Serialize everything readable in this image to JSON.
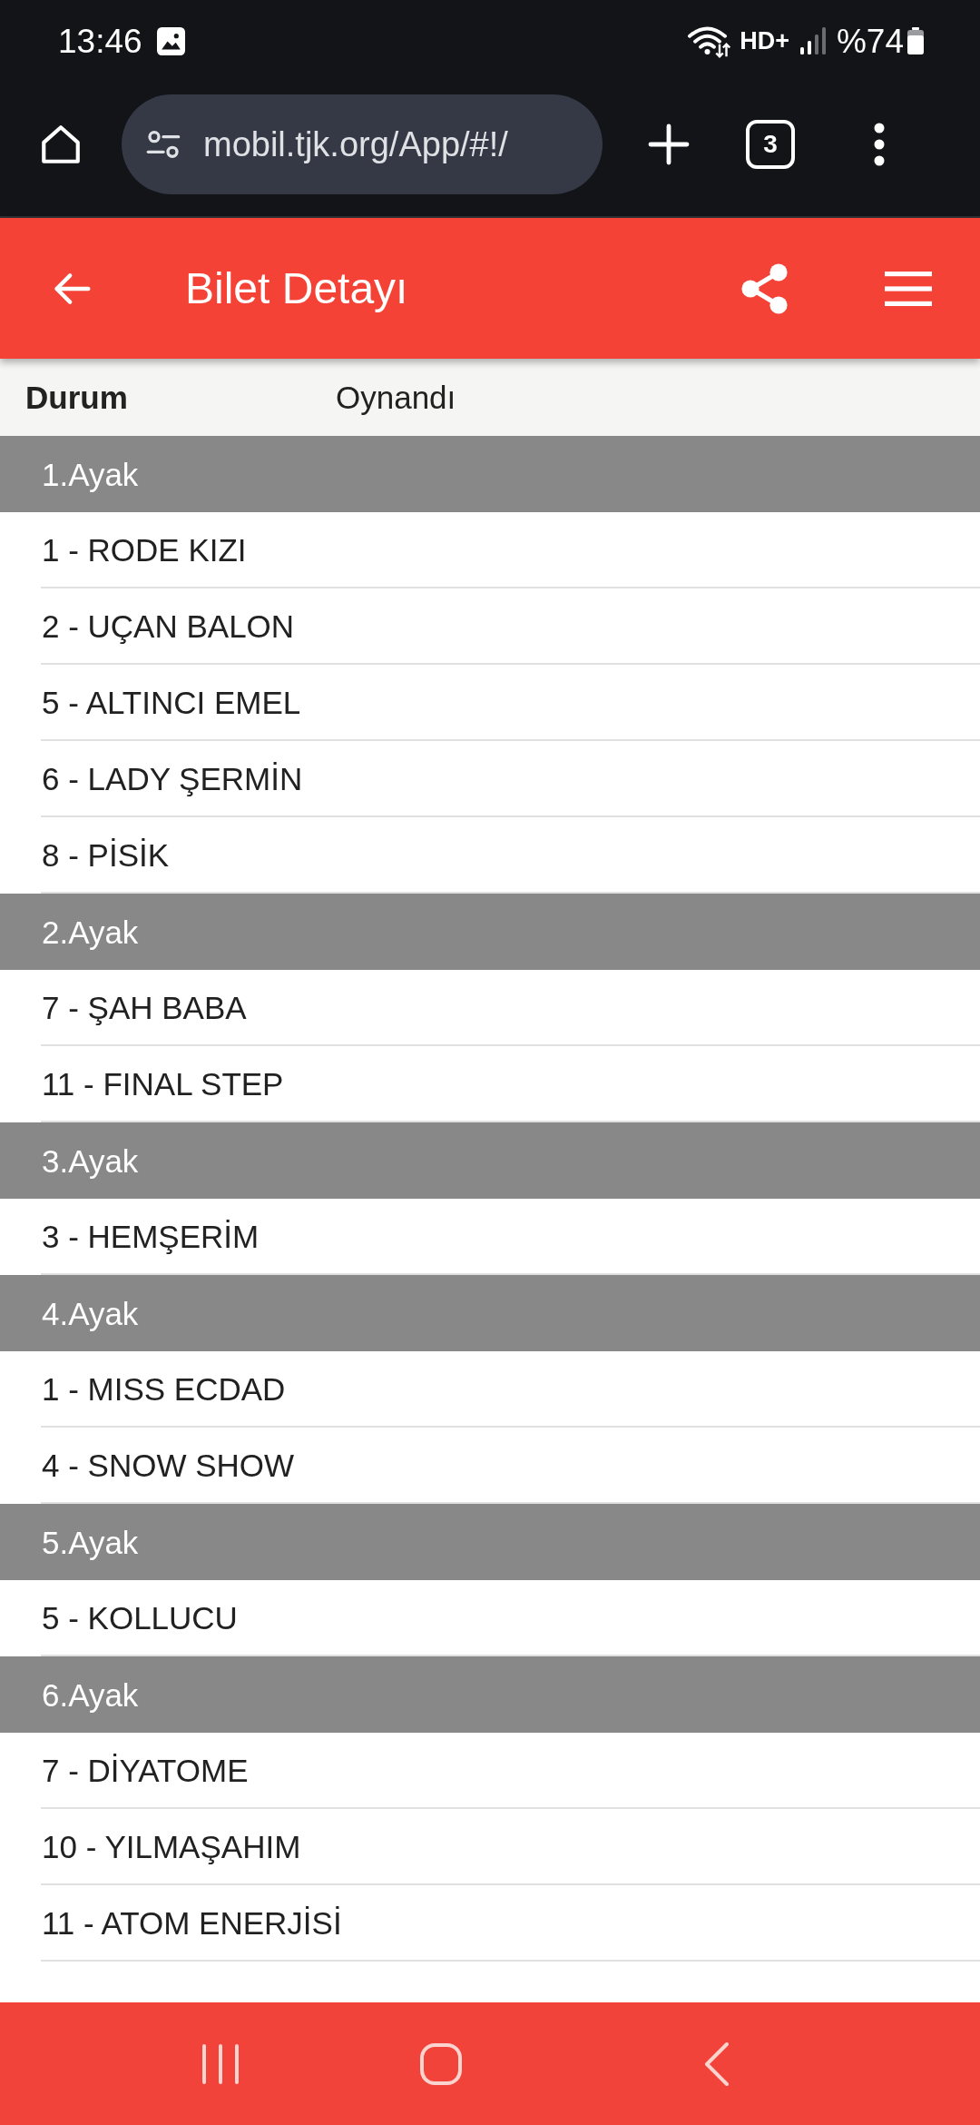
{
  "status_bar": {
    "time": "13:46",
    "network_badge": "HD+",
    "battery": "%74"
  },
  "browser_toolbar": {
    "url": "mobil.tjk.org/App/#!/",
    "tab_count": "3"
  },
  "app_bar": {
    "title": "Bilet Detayı"
  },
  "status_row": {
    "label": "Durum",
    "value": "Oynandı"
  },
  "legs": [
    {
      "title": "1.Ayak",
      "horses": [
        "1 - RODE KIZI",
        "2 - UÇAN BALON",
        "5 - ALTINCI EMEL",
        "6 - LADY ŞERMİN",
        "8 - PİSİK"
      ]
    },
    {
      "title": "2.Ayak",
      "horses": [
        "7 - ŞAH BABA",
        "11 - FINAL STEP"
      ]
    },
    {
      "title": "3.Ayak",
      "horses": [
        "3 - HEMŞERİM"
      ]
    },
    {
      "title": "4.Ayak",
      "horses": [
        "1 - MISS ECDAD",
        "4 - SNOW SHOW"
      ]
    },
    {
      "title": "5.Ayak",
      "horses": [
        "5 - KOLLUCU"
      ]
    },
    {
      "title": "6.Ayak",
      "horses": [
        "7 - DİYATOME",
        "10 - YILMAŞAHIM",
        "11 - ATOM ENERJİSİ"
      ]
    }
  ]
}
